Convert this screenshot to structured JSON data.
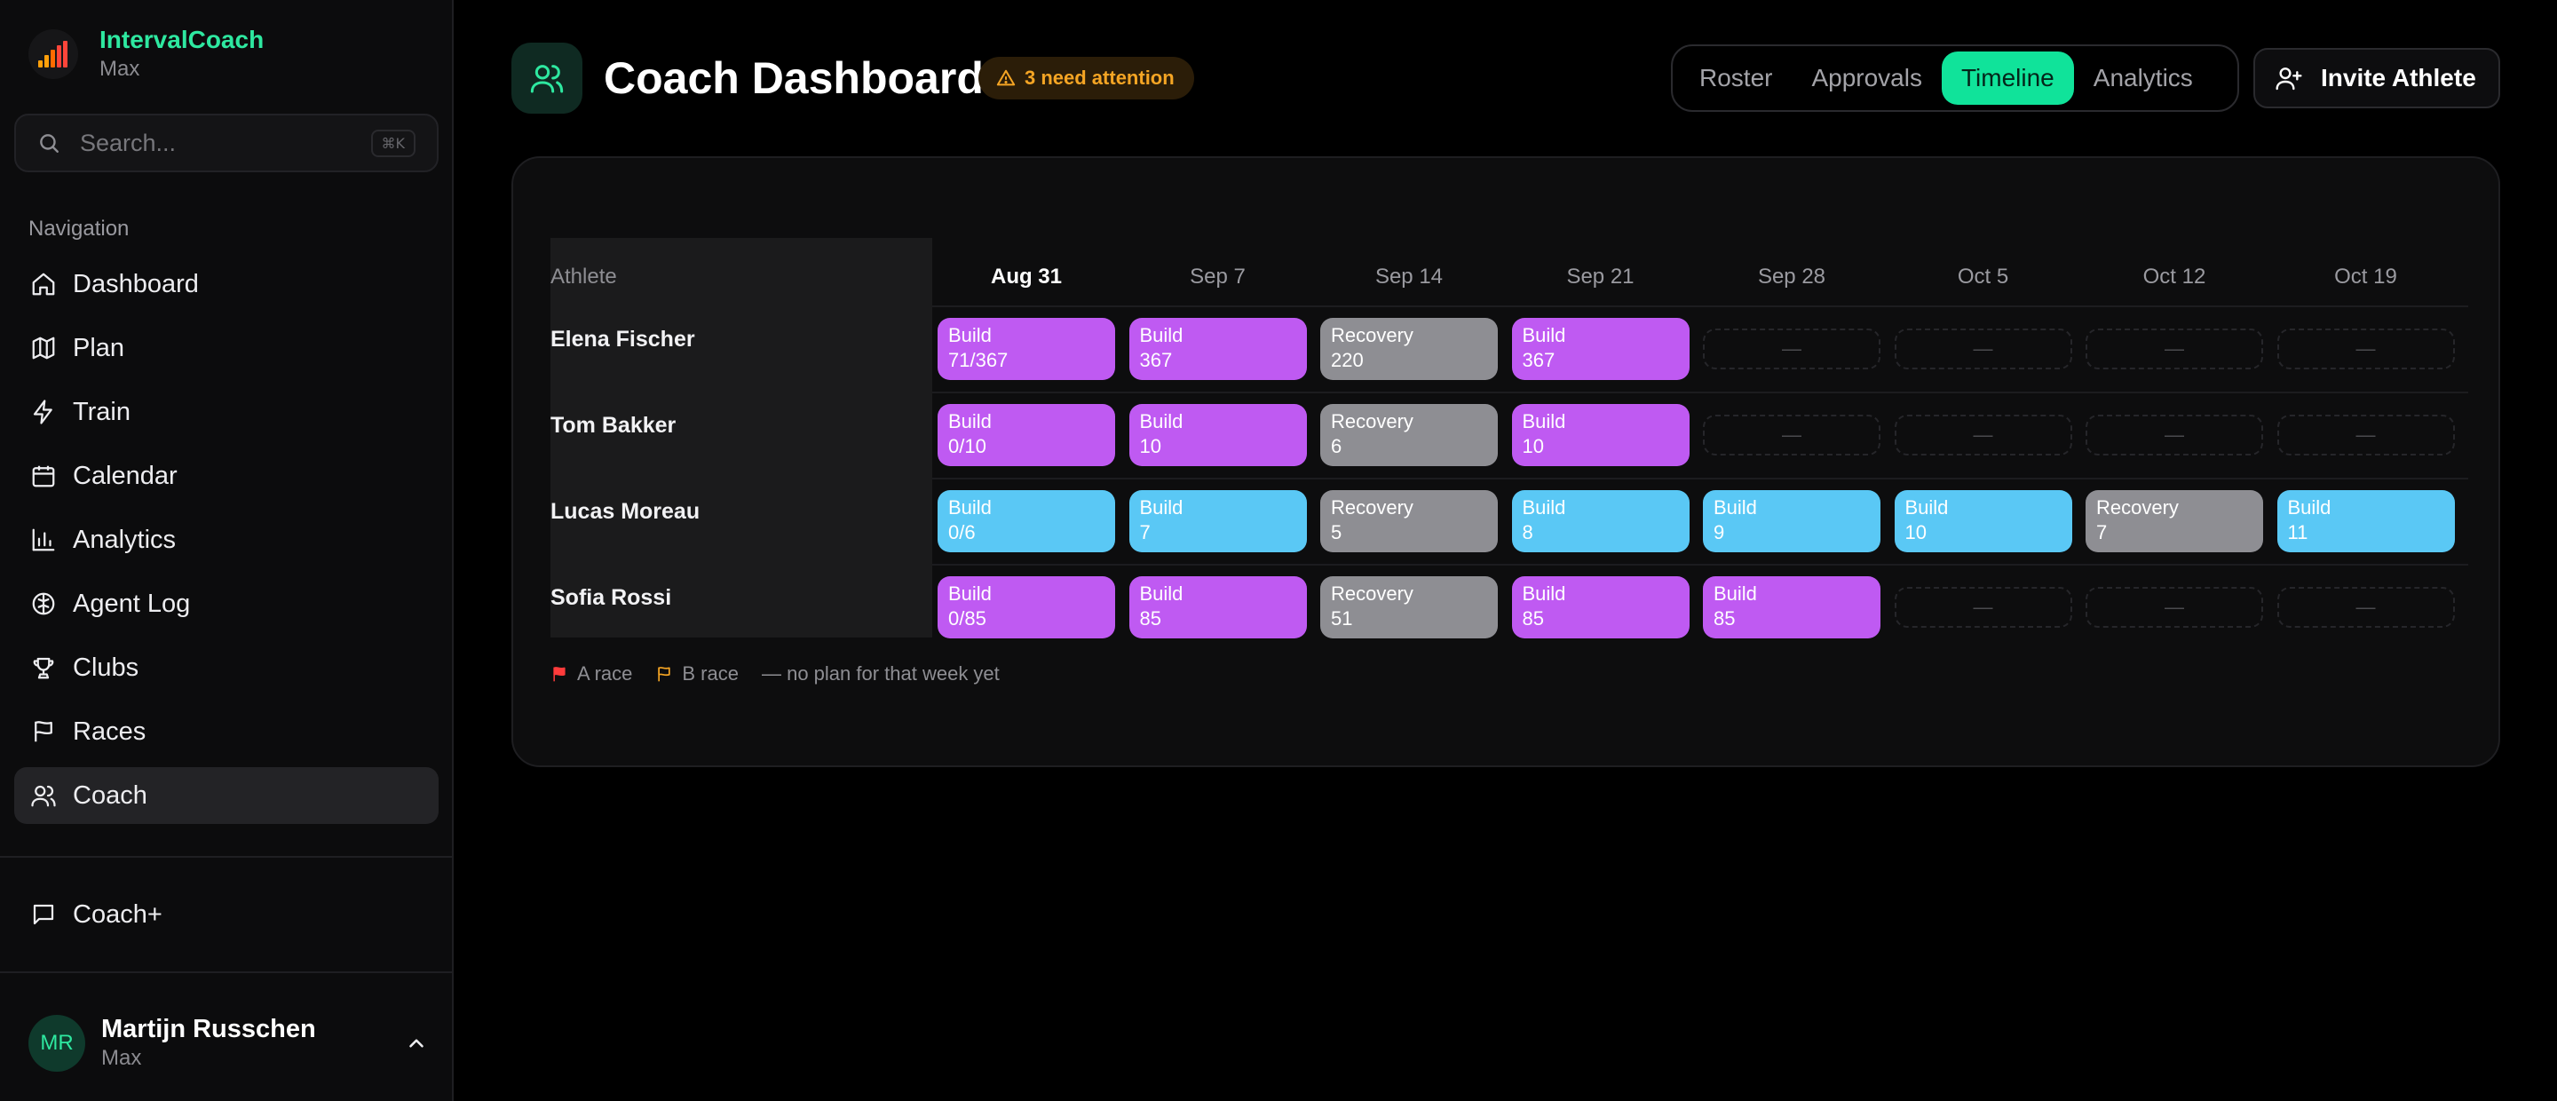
{
  "app": {
    "name": "IntervalCoach",
    "plan": "Max"
  },
  "search": {
    "placeholder": "Search...",
    "shortcut": "⌘K"
  },
  "sidebar": {
    "heading": "Navigation",
    "items": [
      {
        "label": "Dashboard",
        "icon": "home-icon"
      },
      {
        "label": "Plan",
        "icon": "map-icon"
      },
      {
        "label": "Train",
        "icon": "bolt-icon"
      },
      {
        "label": "Calendar",
        "icon": "calendar-icon"
      },
      {
        "label": "Analytics",
        "icon": "bar-chart-icon"
      },
      {
        "label": "Agent Log",
        "icon": "brain-icon"
      },
      {
        "label": "Clubs",
        "icon": "trophy-icon"
      },
      {
        "label": "Races",
        "icon": "flag-icon"
      },
      {
        "label": "Coach",
        "icon": "users-icon",
        "active": true
      }
    ],
    "coachplus": "Coach+"
  },
  "user": {
    "name": "Martijn Russchen",
    "initials": "MR",
    "plan": "Max"
  },
  "header": {
    "title": "Coach Dashboard",
    "attention": "3 need attention",
    "tabs": [
      "Roster",
      "Approvals",
      "Timeline",
      "Analytics"
    ],
    "active_tab": "Timeline",
    "invite": "Invite Athlete"
  },
  "timeline": {
    "athlete_header": "Athlete",
    "weeks": [
      "Aug 31",
      "Sep 7",
      "Sep 14",
      "Sep 21",
      "Sep 28",
      "Oct 5",
      "Oct 12",
      "Oct 19"
    ],
    "current_week": "Aug 31",
    "empty_marker": "—",
    "athletes": [
      {
        "name": "Elena Fischer",
        "color": "#bf5af2",
        "blocks": [
          {
            "phase": "Build",
            "value": "71/367"
          },
          {
            "phase": "Build",
            "value": "367"
          },
          {
            "phase": "Recovery",
            "value": "220"
          },
          {
            "phase": "Build",
            "value": "367"
          },
          null,
          null,
          null,
          null
        ]
      },
      {
        "name": "Tom Bakker",
        "color": "#bf5af2",
        "blocks": [
          {
            "phase": "Build",
            "value": "0/10"
          },
          {
            "phase": "Build",
            "value": "10"
          },
          {
            "phase": "Recovery",
            "value": "6"
          },
          {
            "phase": "Build",
            "value": "10"
          },
          null,
          null,
          null,
          null
        ]
      },
      {
        "name": "Lucas Moreau",
        "color": "#5ac8f5",
        "blocks": [
          {
            "phase": "Build",
            "value": "0/6"
          },
          {
            "phase": "Build",
            "value": "7"
          },
          {
            "phase": "Recovery",
            "value": "5"
          },
          {
            "phase": "Build",
            "value": "8"
          },
          {
            "phase": "Build",
            "value": "9"
          },
          {
            "phase": "Build",
            "value": "10"
          },
          {
            "phase": "Recovery",
            "value": "7"
          },
          {
            "phase": "Build",
            "value": "11"
          }
        ]
      },
      {
        "name": "Sofia Rossi",
        "color": "#bf5af2",
        "blocks": [
          {
            "phase": "Build",
            "value": "0/85"
          },
          {
            "phase": "Build",
            "value": "85"
          },
          {
            "phase": "Recovery",
            "value": "51"
          },
          {
            "phase": "Build",
            "value": "85"
          },
          {
            "phase": "Build",
            "value": "85"
          },
          null,
          null,
          null
        ]
      }
    ],
    "legend": {
      "a_race": "A race",
      "b_race": "B race",
      "no_plan": "— no plan for that week yet"
    }
  },
  "colors": {
    "accent": "#10e39a",
    "build_purple": "#bf5af2",
    "build_blue": "#5ac8f5",
    "recovery": "#8e8e93",
    "warning": "#f5a524",
    "a_race": "#ff3b3b"
  }
}
